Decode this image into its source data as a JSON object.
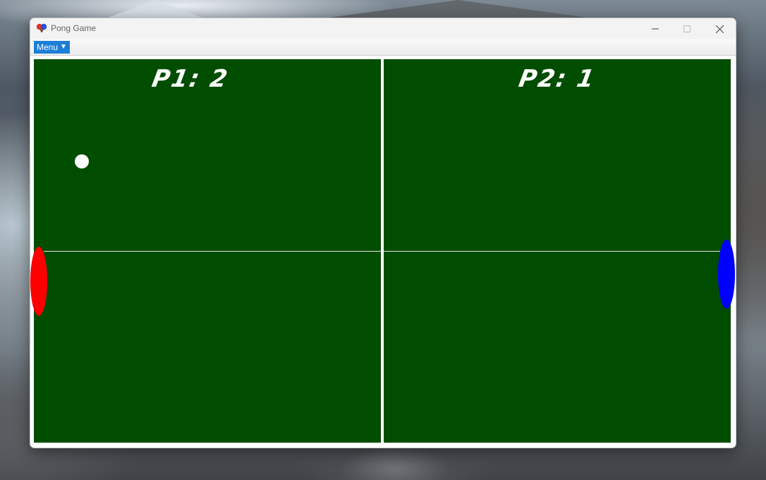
{
  "window": {
    "title": "Pong Game",
    "controls": {
      "minimize_icon": "minimize-icon",
      "maximize_icon": "maximize-icon",
      "close_icon": "close-icon"
    }
  },
  "menubar": {
    "menu_label": "Menu",
    "menu_arrow": "▼"
  },
  "game": {
    "player1": {
      "label": "P1",
      "score_text": "P1: 2",
      "score": 2,
      "paddle_color": "#ff0000"
    },
    "player2": {
      "label": "P2",
      "score_text": "P2: 1",
      "score": 1,
      "paddle_color": "#0000ff"
    },
    "court_color": "#004d00",
    "ball_color": "#ffffff"
  }
}
